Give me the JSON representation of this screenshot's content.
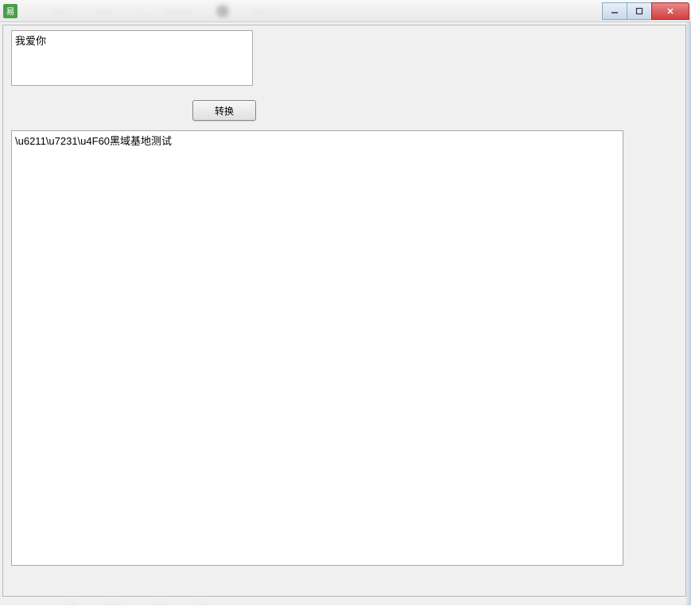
{
  "titlebar": {
    "icon_label": "易"
  },
  "controls": {
    "minimize_symbol": "—",
    "maximize_symbol": "▢",
    "close_symbol": "✕"
  },
  "main": {
    "input_value": "我爱你",
    "convert_label": "转换",
    "output_value": "\\u6211\\u7231\\u4F60黑域基地测试"
  }
}
